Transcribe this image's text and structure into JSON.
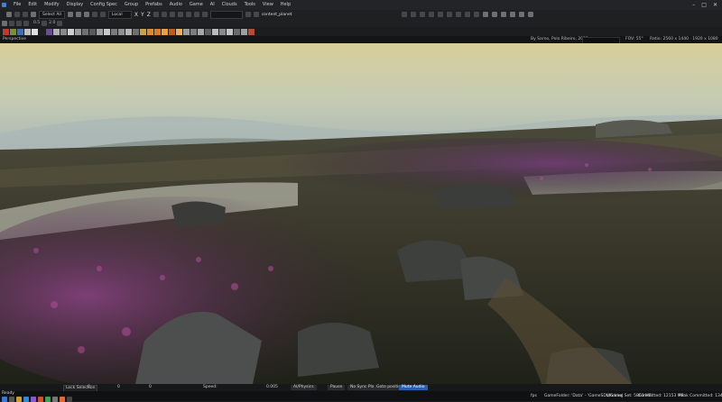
{
  "menubar": {
    "items": [
      "File",
      "Edit",
      "Modify",
      "Display",
      "Config Spec",
      "Group",
      "Prefabs",
      "Audio",
      "Game",
      "AI",
      "Clouds",
      "Tools",
      "View",
      "Help"
    ]
  },
  "toolbar": {
    "select_mode": "Select All",
    "coord_space": "Local",
    "axis_labels": [
      "X",
      "Y",
      "Z"
    ],
    "layer_value": "",
    "object_name": "content_planet"
  },
  "toolbar2": {
    "icons": [
      "pan",
      "rotate",
      "scale",
      "snap"
    ],
    "value_a": "0.5",
    "value_b": "2.0"
  },
  "textures": {
    "swatches": [
      "#c0392b",
      "#7a8f3a",
      "#3f6fb0",
      "#bfbfbf",
      "#e0e0e0",
      "#202020",
      "#6b4c9a",
      "#b0b0b0",
      "#888888",
      "#cfcfcf",
      "#9a9a9a",
      "#707070",
      "#5a5a5a",
      "#a0a0a0",
      "#c8c8c8",
      "#7b7b7b",
      "#909090",
      "#b5b5b5",
      "#6f6f6f",
      "#d0a040",
      "#e08a2a",
      "#e07a20",
      "#f0a030",
      "#c85a18",
      "#e8b060",
      "#9c9c9c",
      "#7d7d7d",
      "#a8a8a8",
      "#5d5d5d",
      "#bbbbbb",
      "#8a8a8a",
      "#c3c3c3",
      "#6a6a6a",
      "#9f9f9f",
      "#c14a2a"
    ]
  },
  "viewport": {
    "label": "Perspective",
    "author": "By Sarno, Polo Ribeiro, 2022",
    "fov_label": "FOV:",
    "fov_value": "55°",
    "ratio_label": "Ratio: 2560 x 1440 · 1920 x 1080"
  },
  "statusbar": {
    "lock_selection": "Lock Selection",
    "x_value": "0",
    "y_value": "0",
    "z_value": "0",
    "speed_label": "Speed:",
    "speed_value": "0.005",
    "ai_physics": "AI/Physics",
    "pause": "Pause",
    "no_sync_player": "No Sync Player",
    "goto_position": "Goto position",
    "mute_audio": "Mute Audio",
    "ready": "Ready",
    "game_folder": "GameFolder: 'Data' - 'GameSDL/Game'",
    "working_set": "Working Set: 5863 MB",
    "committed": "Committed: 12153 MB",
    "peak": "Peak Committed: 13410 MB",
    "fps": "fps"
  }
}
